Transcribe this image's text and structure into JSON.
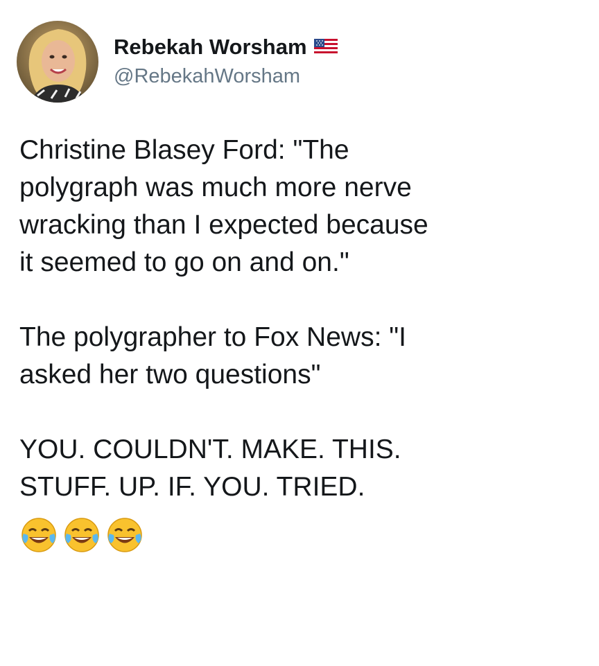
{
  "tweet": {
    "display_name": "Rebekah Worsham",
    "handle": "@RebekahWorsham",
    "icons": {
      "avatar": "profile-photo",
      "flag": "us-flag-icon",
      "emoji": "tears-of-joy-emoji"
    },
    "paragraphs": [
      "Christine Blasey Ford: \"The\npolygraph was much more nerve\nwracking than I expected because\nit seemed to go on and on.\"",
      "The polygrapher to Fox News: \"I\nasked her two questions\"",
      "YOU. COULDN'T. MAKE. THIS.\nSTUFF. UP. IF. YOU. TRIED."
    ],
    "emoji_count": 3
  },
  "colors": {
    "text": "#14171a",
    "handle": "#657786",
    "background": "#ffffff",
    "emoji_face": "#f9c22e"
  }
}
